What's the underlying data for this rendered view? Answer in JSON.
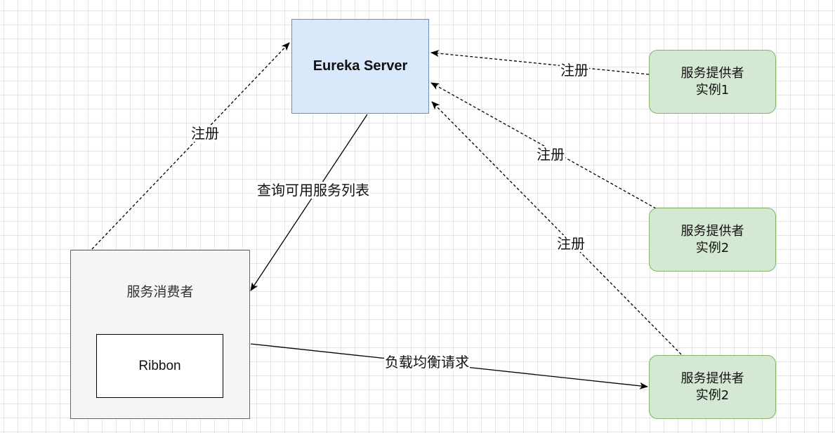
{
  "nodes": {
    "server": {
      "label": "Eureka Server"
    },
    "provider_1": {
      "line1": "服务提供者",
      "line2": "实例1"
    },
    "provider_2": {
      "line1": "服务提供者",
      "line2": "实例2"
    },
    "provider_3": {
      "line1": "服务提供者",
      "line2": "实例2"
    },
    "consumer": {
      "label": "服务消费者"
    },
    "ribbon": {
      "label": "Ribbon"
    }
  },
  "edges": {
    "consumer_register": {
      "label": "注册"
    },
    "provider_1_register": {
      "label": "注册"
    },
    "provider_2_register": {
      "label": "注册"
    },
    "provider_3_register": {
      "label": "注册"
    },
    "query_services": {
      "label": "查询可用服务列表"
    },
    "load_balance": {
      "label": "负载均衡请求"
    }
  },
  "colors": {
    "server_fill": "#dae8fc",
    "server_border": "#6c8ebf",
    "provider_fill": "#d5e8d4",
    "provider_border": "#82b366",
    "consumer_fill": "#f5f5f5",
    "consumer_border": "#666666"
  }
}
